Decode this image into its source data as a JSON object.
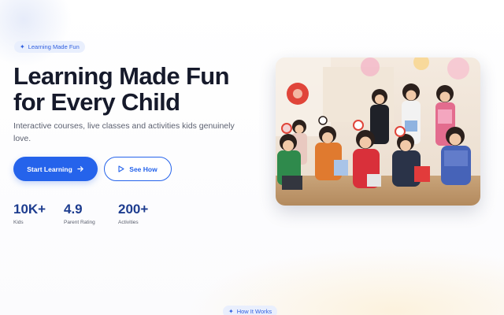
{
  "hero": {
    "badge": {
      "label": "Learning Made Fun",
      "icon": "sparkle-icon"
    },
    "title_line1": "Learning Made Fun",
    "title_line2": "for Every Child",
    "subtitle": "Interactive courses, live classes and activities kids genuinely love.",
    "primary_button": {
      "label": "Start Learning",
      "icon": "arrow-right-icon"
    },
    "secondary_button": {
      "label": "See How",
      "icon": "play-icon"
    },
    "stats": [
      {
        "value": "10K+",
        "label": "Kids"
      },
      {
        "value": "4.9",
        "label": "Parent Rating"
      },
      {
        "value": "200+",
        "label": "Activities"
      }
    ],
    "image": {
      "subject": "group of young children sitting on a classroom floor holding crafts"
    }
  },
  "how_it_works": {
    "badge": {
      "label": "How It Works",
      "icon": "sparkle-icon"
    }
  },
  "colors": {
    "accent": "#2563eb",
    "badge_bg": "#e9effd",
    "heading": "#161a2b",
    "stat_value": "#1d3c8f",
    "muted_text": "#5c6170"
  }
}
